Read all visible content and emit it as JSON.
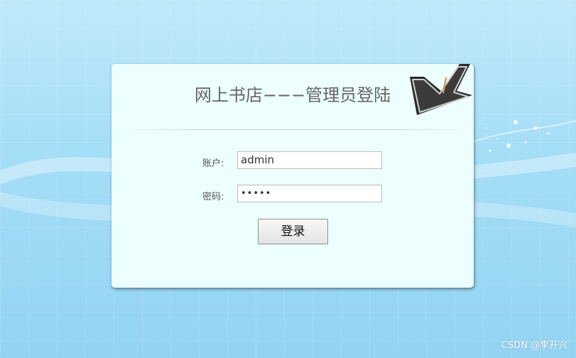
{
  "login": {
    "title": "网上书店−−−管理员登陆",
    "username_label": "账户:",
    "username_value": "admin",
    "password_label": "密码:",
    "password_value": "•••••",
    "submit_label": "登录"
  },
  "watermark": "CSDN @李开兴",
  "colors": {
    "card_background": "#ecfefe",
    "page_background": "#a6def7",
    "title_text": "#666666"
  },
  "icons": {
    "decor_arrow": "arrow-icon"
  }
}
